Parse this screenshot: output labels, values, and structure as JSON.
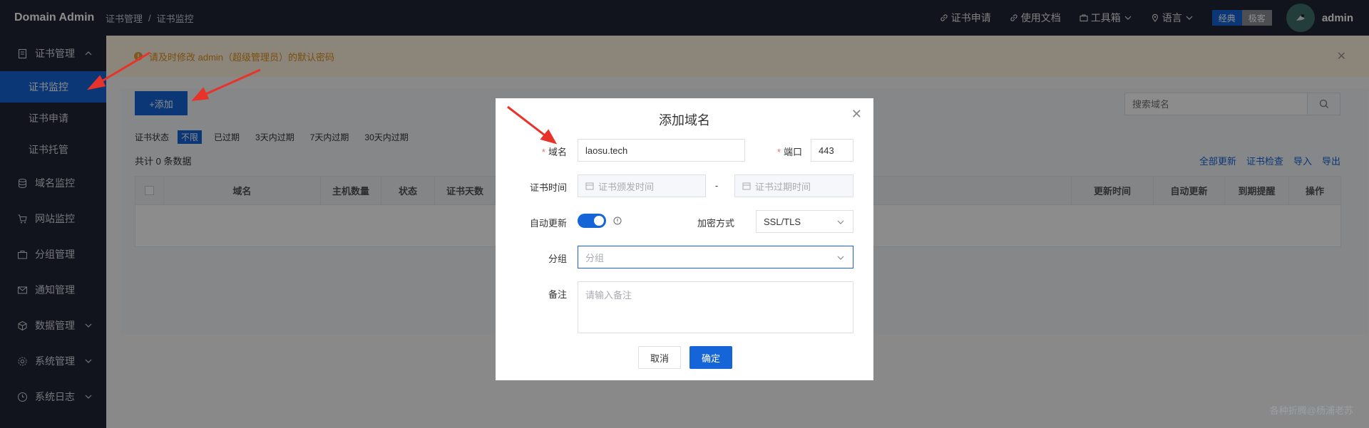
{
  "header": {
    "brand": "Domain Admin",
    "breadcrumb": [
      "证书管理",
      "/",
      "证书监控"
    ],
    "nav": [
      {
        "label": "证书申请",
        "icon": "link-icon"
      },
      {
        "label": "使用文档",
        "icon": "link-icon"
      },
      {
        "label": "工具箱",
        "icon": "toolbox-icon"
      },
      {
        "label": "语言",
        "icon": "location-icon"
      }
    ],
    "theme_on": "经典",
    "theme_off": "极客",
    "username": "admin"
  },
  "sidebar": {
    "cert_group": "证书管理",
    "cert_items": [
      "证书监控",
      "证书申请",
      "证书托管"
    ],
    "items": [
      "域名监控",
      "网站监控",
      "分组管理",
      "通知管理",
      "数据管理",
      "系统管理",
      "系统日志"
    ]
  },
  "notice": "请及时修改 admin（超级管理员）的默认密码",
  "toolbar": {
    "add_label": "+添加",
    "search_placeholder": "搜索域名"
  },
  "filters": {
    "label": "证书状态",
    "chips": [
      "不限",
      "已过期",
      "3天内过期",
      "7天内过期",
      "30天内过期"
    ]
  },
  "total": "共计 0 条数据",
  "actions": [
    "全部更新",
    "证书检查",
    "导入",
    "导出"
  ],
  "table": {
    "columns": [
      "域名",
      "主机数量",
      "状态",
      "证书天数",
      "更新时间",
      "自动更新",
      "到期提醒",
      "操作"
    ]
  },
  "modal": {
    "title": "添加域名",
    "domain_label": "域名",
    "domain_value": "laosu.tech",
    "port_label": "端口",
    "port_value": "443",
    "cert_time_label": "证书时间",
    "cert_start_placeholder": "证书颁发时间",
    "cert_dash": "-",
    "cert_end_placeholder": "证书过期时间",
    "auto_update_label": "自动更新",
    "encrypt_label": "加密方式",
    "encrypt_value": "SSL/TLS",
    "group_label": "分组",
    "group_placeholder": "分组",
    "remark_label": "备注",
    "remark_placeholder": "请输入备注",
    "cancel": "取消",
    "confirm": "确定"
  },
  "watermark": "各种折腾@杨浦老苏",
  "colors": {
    "primary": "#1665d8",
    "sidebar": "#1f2633",
    "annotation": "#e8332a"
  }
}
